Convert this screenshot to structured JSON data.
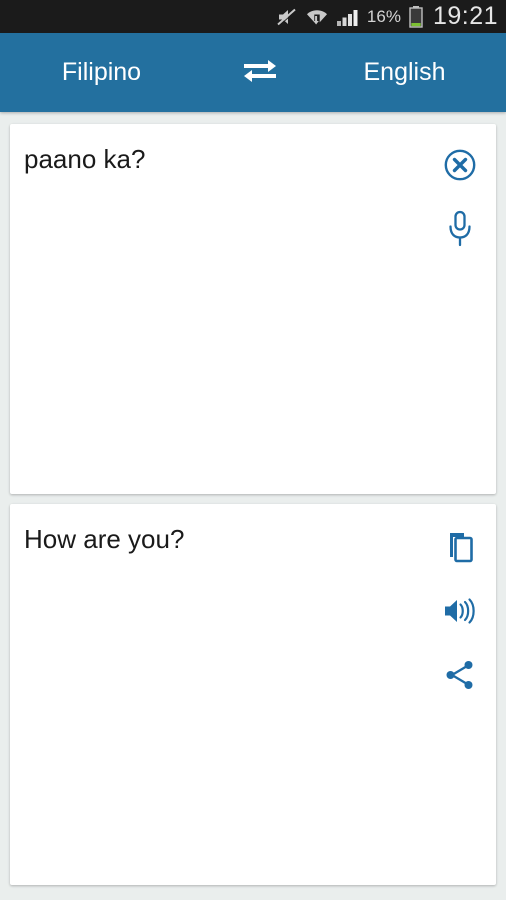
{
  "status_bar": {
    "icons": [
      {
        "name": "volume-muted-icon",
        "label": "muted"
      },
      {
        "name": "wifi-transfer-icon",
        "label": "wifi"
      },
      {
        "name": "signal-bars-icon",
        "label": "signal"
      }
    ],
    "battery_percent": "16%",
    "battery_icon": "battery-low-icon",
    "clock": "19:21",
    "background_color": "#1b1b1b",
    "text_color": "#d3d3d3"
  },
  "header": {
    "source_language": "Filipino",
    "target_language": "English",
    "swap_icon": "swap-horizontal-icon",
    "background_color": "#23709f",
    "text_color": "#ffffff"
  },
  "input_card": {
    "text": "paano ka?",
    "clear_icon": "clear-circle-icon",
    "mic_icon": "microphone-icon",
    "icon_color": "#1f6ca6",
    "text_color": "#1a1a1a"
  },
  "output_card": {
    "text": "How are you?",
    "copy_icon": "copy-icon",
    "speak_icon": "speaker-volume-icon",
    "share_icon": "share-icon",
    "icon_color": "#1f6ca6",
    "text_color": "#1a1a1a"
  },
  "theme": {
    "page_background": "#eaeeed",
    "card_background": "#ffffff",
    "accent": "#23709f"
  }
}
